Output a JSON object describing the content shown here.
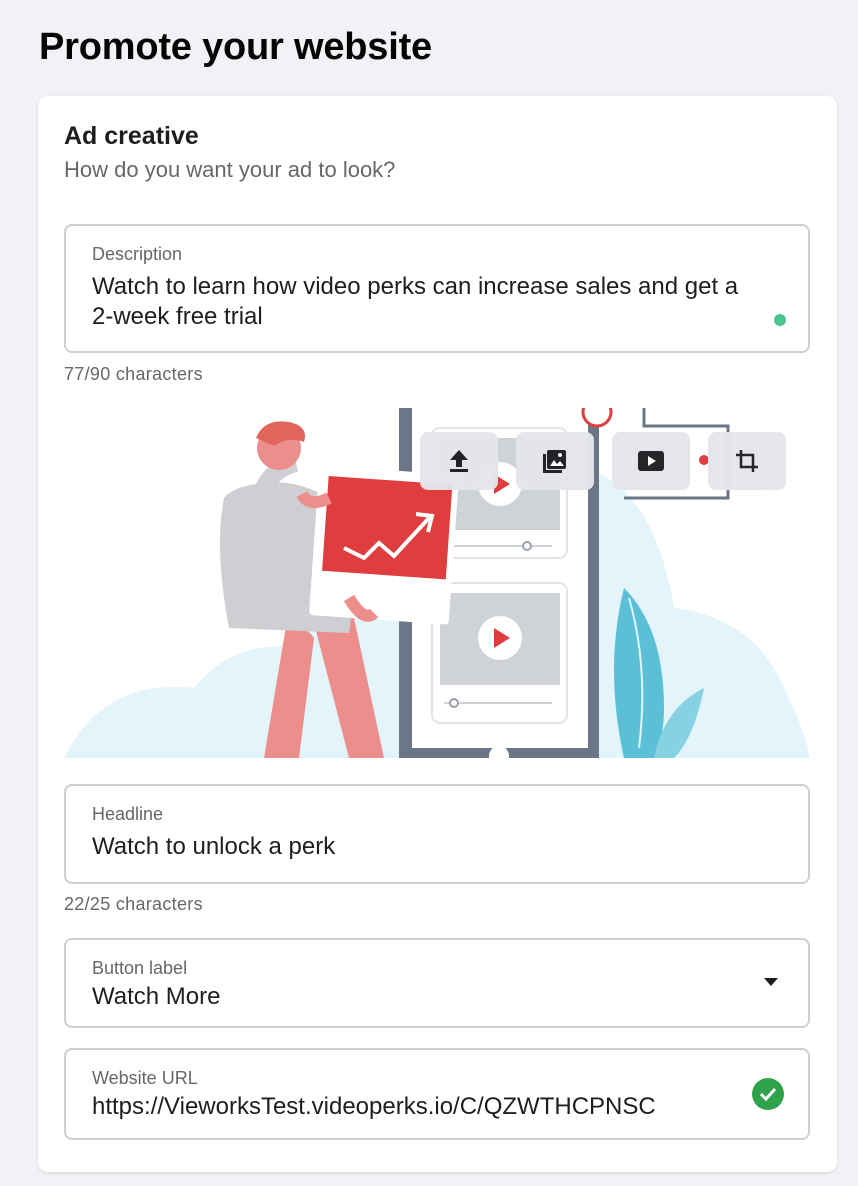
{
  "page": {
    "title": "Promote your website"
  },
  "ad_creative": {
    "title": "Ad creative",
    "subtitle": "How do you want your ad to look?"
  },
  "description": {
    "label": "Description",
    "value": "Watch to learn how video perks can increase sales and get a 2-week free trial",
    "counter": "77/90 characters",
    "status_color": "#4cc494"
  },
  "media": {
    "tools": [
      {
        "icon": "upload-icon"
      },
      {
        "icon": "image-gallery-icon"
      },
      {
        "icon": "video-icon"
      },
      {
        "icon": "crop-icon"
      }
    ]
  },
  "headline": {
    "label": "Headline",
    "value": "Watch to unlock a perk",
    "counter": "22/25 characters"
  },
  "button_label": {
    "label": "Button label",
    "value": "Watch More"
  },
  "website_url": {
    "label": "Website URL",
    "value": "https://VieworksTest.videoperks.io/C/QZWTHCPNSC",
    "status_color": "#31a24c"
  }
}
